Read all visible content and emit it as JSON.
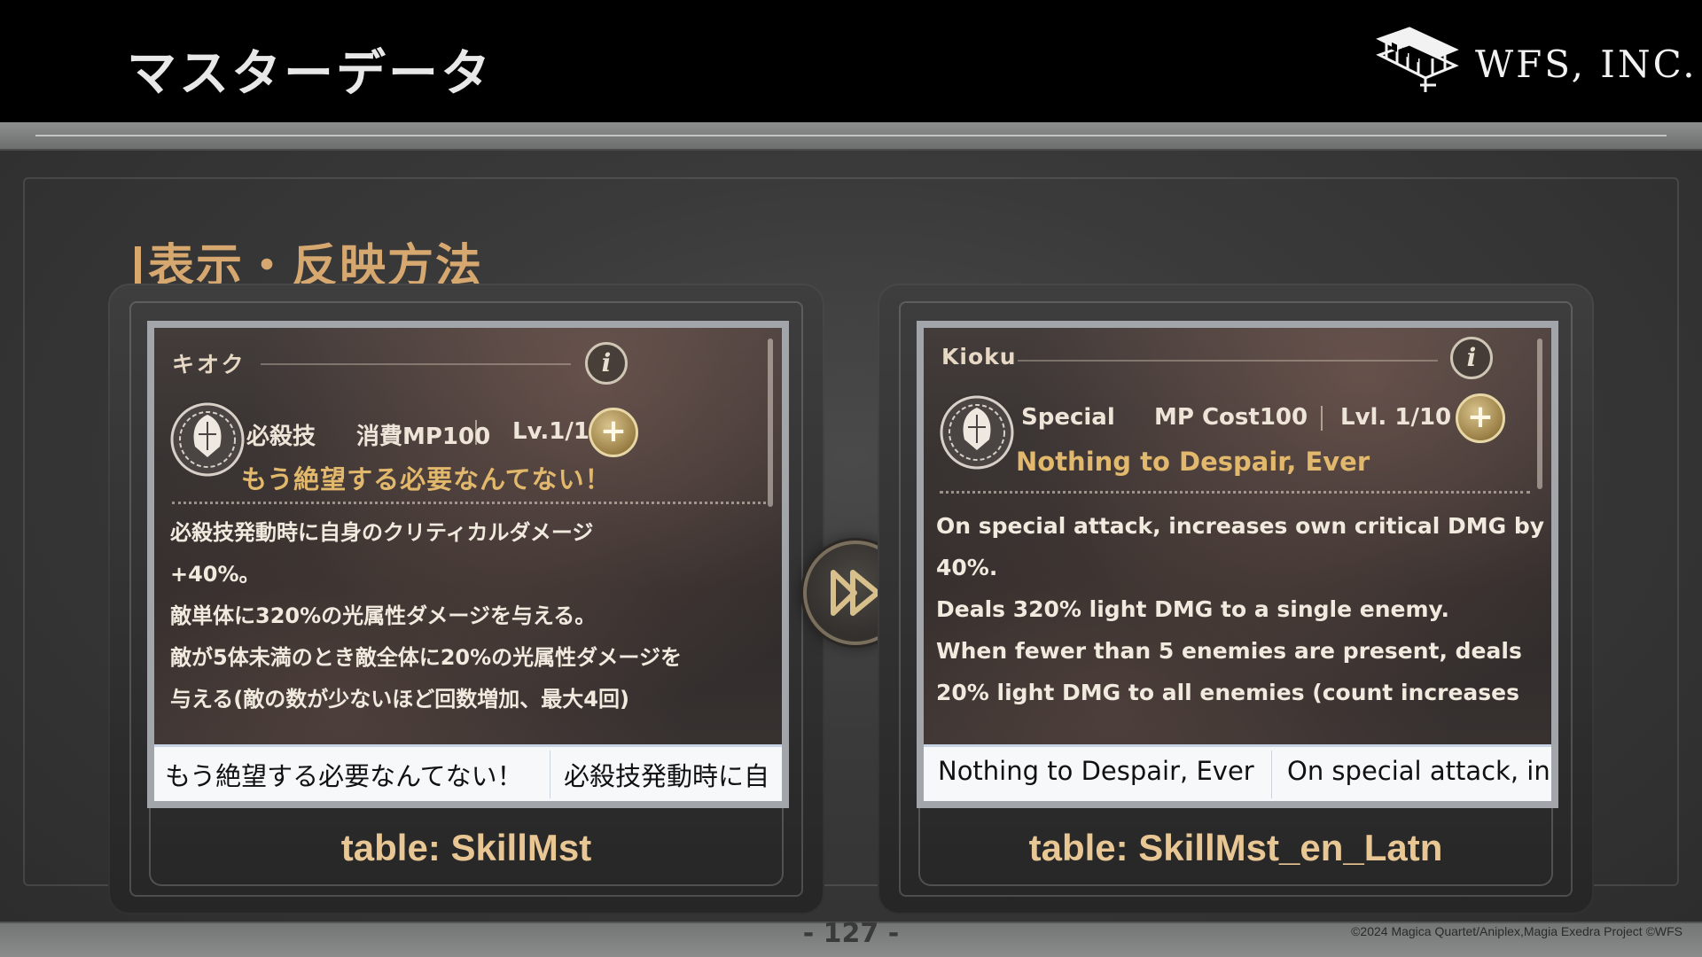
{
  "header": {
    "title": "マスターデータ",
    "logo_text": "WFS, INC."
  },
  "section": {
    "heading": "表示・反映方法"
  },
  "left_card": {
    "category": "キオク",
    "info_glyph": "i",
    "skill_type": "必殺技",
    "mp_cost": "消費MP100",
    "level": "Lv.1/10",
    "plus_glyph": "+",
    "skill_name": "もう絶望する必要なんてない！",
    "description_lines": [
      "必殺技発動時に自身のクリティカルダメージ",
      "+40%。",
      "敵単体に320%の光属性ダメージを与える。",
      "敵が5体未満のとき敵全体に20%の光属性ダメージを",
      "与える(敵の数が少ないほど回数増加、最大4回)"
    ],
    "strip": {
      "name_cell": "もう絶望する必要なんてない！",
      "desc_cell": "必殺技発動時に自"
    },
    "table_label": "table: SkillMst"
  },
  "right_card": {
    "category": "Kioku",
    "info_glyph": "i",
    "skill_type": "Special",
    "mp_cost": "MP Cost100",
    "level": "Lvl. 1/10",
    "plus_glyph": "+",
    "skill_name": "Nothing to Despair, Ever",
    "description_lines": [
      "On special attack, increases own critical DMG by",
      "40%.",
      "Deals 320% light DMG to a single enemy.",
      "When fewer than 5 enemies are present, deals",
      "20% light DMG to all enemies (count increases"
    ],
    "strip": {
      "name_cell": "Nothing to Despair, Ever",
      "desc_cell": "On special attack, in"
    },
    "table_label": "table: SkillMst_en_Latn"
  },
  "arrow": {
    "icon": "fast-forward-icon"
  },
  "footer": {
    "page_number": "- 127 -",
    "copyright": "©2024 Magica Quartet/Aniplex,Magia Exedra Project ©WFS"
  }
}
